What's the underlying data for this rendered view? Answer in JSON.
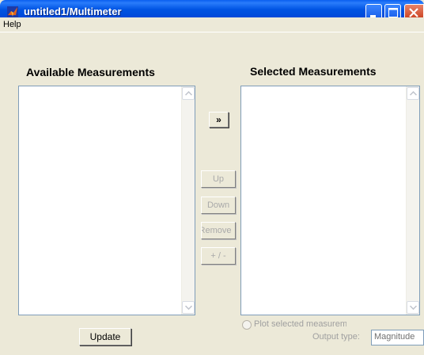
{
  "window": {
    "title": "untitled1/Multimeter",
    "controls": [
      "minimize-icon",
      "maximize-icon",
      "close-icon"
    ]
  },
  "menu": {
    "items": [
      "Help"
    ]
  },
  "available": {
    "heading": "Available Measurements",
    "items": []
  },
  "selected": {
    "heading": "Selected Measurements",
    "items": []
  },
  "buttons": {
    "add": "»",
    "up": "Up",
    "down": "Down",
    "remove": "Remove",
    "plus_minus": "+ / -",
    "update": "Update"
  },
  "options": {
    "plot_label": "Plot selected measurements",
    "output_type_label": "Output type:",
    "output_type_value": "Magnitude"
  },
  "colors": {
    "titlebar": "#0054e3",
    "window_bg": "#ece9d8",
    "disabled_text": "#a0a0a0"
  }
}
